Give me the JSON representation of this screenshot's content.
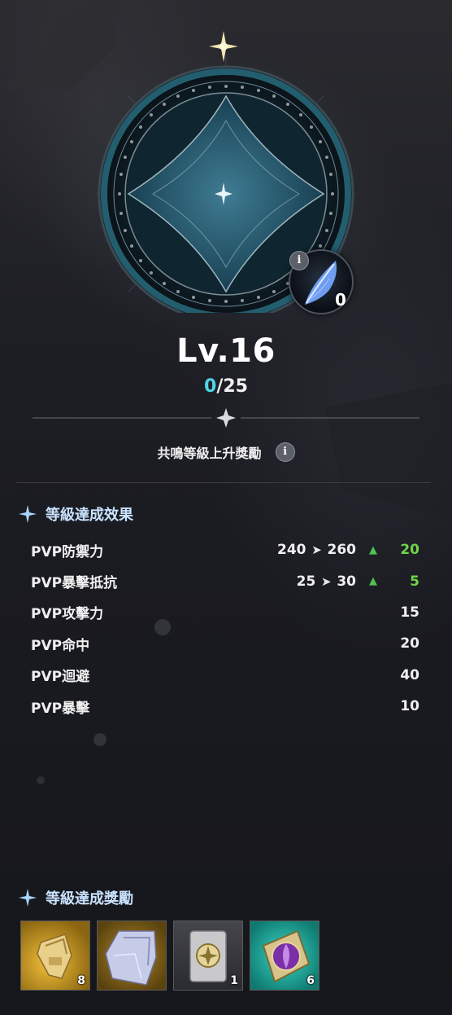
{
  "level": {
    "title": "Lv.16",
    "exp_current": "0",
    "exp_separator": "/",
    "exp_max": "25"
  },
  "feather": {
    "count": "0",
    "info_glyph": "i"
  },
  "bonus": {
    "label": "共鳴等級上升獎勵",
    "info_glyph": "i"
  },
  "effects": {
    "title": "等級達成效果",
    "rows": [
      {
        "name": "PVP防禦力",
        "from": "240",
        "arrow": "➤",
        "to": "260",
        "up": "▲",
        "diff": "20"
      },
      {
        "name": "PVP暴擊抵抗",
        "from": "25",
        "arrow": "➤",
        "to": "30",
        "up": "▲",
        "diff": "5"
      },
      {
        "name": "PVP攻擊力",
        "value": "15"
      },
      {
        "name": "PVP命中",
        "value": "20"
      },
      {
        "name": "PVP迴避",
        "value": "40"
      },
      {
        "name": "PVP暴擊",
        "value": "10"
      }
    ]
  },
  "rewards": {
    "title": "等級達成獎勵",
    "items": [
      {
        "icon": "gold-scroll-icon",
        "count": "8",
        "bg": "#b8901a"
      },
      {
        "icon": "silver-cloak-icon",
        "count": "",
        "bg": "#8a6a1a"
      },
      {
        "icon": "rune-scroll-icon",
        "count": "1",
        "bg": "#3a3b40"
      },
      {
        "icon": "purple-emblem-icon",
        "count": "6",
        "bg": "#1fa59a"
      }
    ]
  },
  "colors": {
    "accent": "#4fd6e8",
    "increase": "#6fd34a",
    "section_title": "#c9e3ff"
  }
}
